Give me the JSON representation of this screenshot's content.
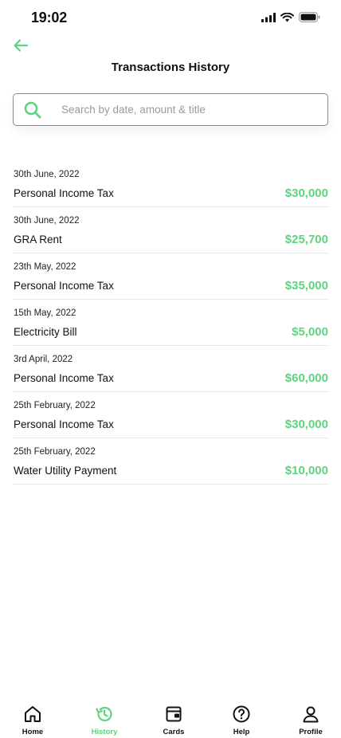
{
  "status": {
    "time": "19:02"
  },
  "header": {
    "title": "Transactions History"
  },
  "search": {
    "placeholder": "Search by date, amount & title",
    "value": ""
  },
  "colors": {
    "accent": "#5fd37f",
    "divider": "#d7f3e0",
    "text": "#111111"
  },
  "transactions": [
    {
      "date": "30th June, 2022",
      "title": "Personal Income Tax",
      "amount": "$30,000"
    },
    {
      "date": "30th June, 2022",
      "title": "GRA Rent",
      "amount": "$25,700"
    },
    {
      "date": "23th May, 2022",
      "title": "Personal Income Tax",
      "amount": "$35,000"
    },
    {
      "date": "15th May, 2022",
      "title": "Electricity Bill",
      "amount": "$5,000"
    },
    {
      "date": "3rd April, 2022",
      "title": "Personal Income Tax",
      "amount": "$60,000"
    },
    {
      "date": "25th February, 2022",
      "title": "Personal Income Tax",
      "amount": "$30,000"
    },
    {
      "date": "25th February, 2022",
      "title": "Water Utility Payment",
      "amount": "$10,000"
    }
  ],
  "tabs": [
    {
      "label": "Home",
      "icon": "home-icon",
      "active": false
    },
    {
      "label": "History",
      "icon": "history-icon",
      "active": true
    },
    {
      "label": "Cards",
      "icon": "wallet-icon",
      "active": false
    },
    {
      "label": "Help",
      "icon": "help-icon",
      "active": false
    },
    {
      "label": "Profile",
      "icon": "profile-icon",
      "active": false
    }
  ]
}
